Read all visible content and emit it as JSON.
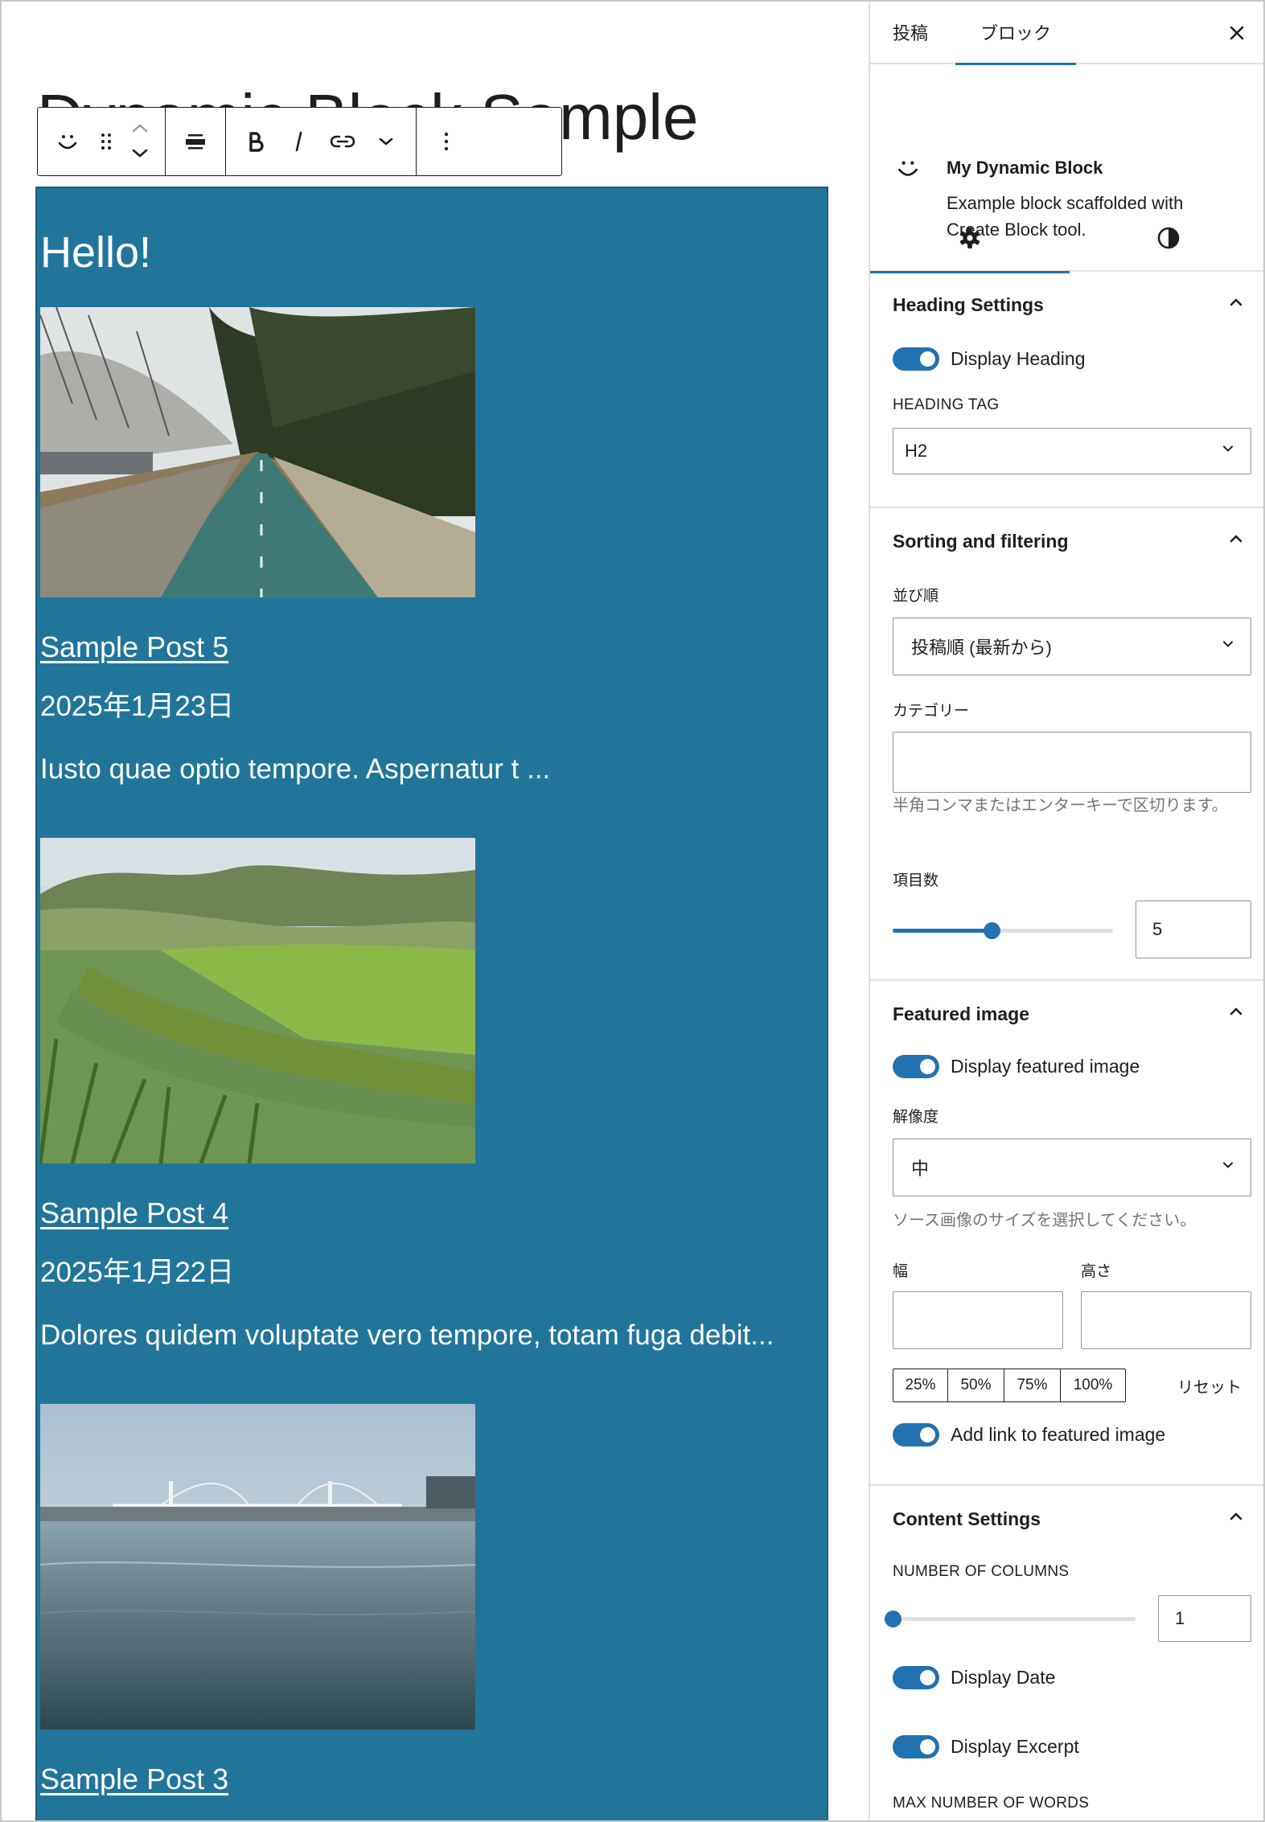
{
  "editor": {
    "page_title": "Dynamic Block Sample"
  },
  "toolbar": {
    "buttons": [
      "block-type",
      "drag-handle",
      "move-up-down",
      "align",
      "bold",
      "italic",
      "link",
      "more-rich-text",
      "options"
    ]
  },
  "block": {
    "heading": "Hello!",
    "background_color": "#21759b",
    "posts": [
      {
        "title": "Sample Post 5",
        "date": "2025年1月23日",
        "excerpt": "Iusto quae optio tempore. Aspernatur t ..."
      },
      {
        "title": "Sample Post 4",
        "date": "2025年1月22日",
        "excerpt": "Dolores quidem voluptate vero tempore, totam fuga debit..."
      },
      {
        "title": "Sample Post 3"
      }
    ]
  },
  "sidebar": {
    "tabs": [
      {
        "label": "投稿",
        "active": false
      },
      {
        "label": "ブロック",
        "active": true
      }
    ],
    "close_icon": "close-icon",
    "block_card": {
      "title": "My Dynamic Block",
      "description": "Example block scaffolded with Create Block tool."
    },
    "inspector_tabs": [
      {
        "icon": "gear-icon",
        "active": true
      },
      {
        "icon": "styles-icon",
        "active": false
      }
    ],
    "heading_settings": {
      "title": "Heading Settings",
      "display_heading_label": "Display Heading",
      "display_heading": true,
      "heading_tag_label": "HEADING TAG",
      "heading_tag_value": "H2"
    },
    "sorting": {
      "title": "Sorting and filtering",
      "order_label": "並び順",
      "order_value": "投稿順 (最新から)",
      "category_label": "カテゴリー",
      "category_value": "",
      "category_help": "半角コンマまたはエンターキーで区切ります。",
      "count_label": "項目数",
      "count_value": "5",
      "count_fraction": 0.45
    },
    "featured_image": {
      "title": "Featured image",
      "display_label": "Display featured image",
      "display": true,
      "resolution_label": "解像度",
      "resolution_value": "中",
      "resolution_help": "ソース画像のサイズを選択してください。",
      "width_label": "幅",
      "height_label": "高さ",
      "width_value": "",
      "height_value": "",
      "size_buttons": [
        "25%",
        "50%",
        "75%",
        "100%"
      ],
      "reset_label": "リセット",
      "link_label": "Add link to featured image",
      "link": true
    },
    "content_settings": {
      "title": "Content Settings",
      "columns_label": "NUMBER OF COLUMNS",
      "columns_value": "1",
      "columns_fraction": 0.0,
      "display_date_label": "Display Date",
      "display_date": true,
      "display_excerpt_label": "Display Excerpt",
      "display_excerpt": true,
      "max_words_label": "MAX NUMBER OF WORDS"
    },
    "accent_color": "#2271b1"
  }
}
